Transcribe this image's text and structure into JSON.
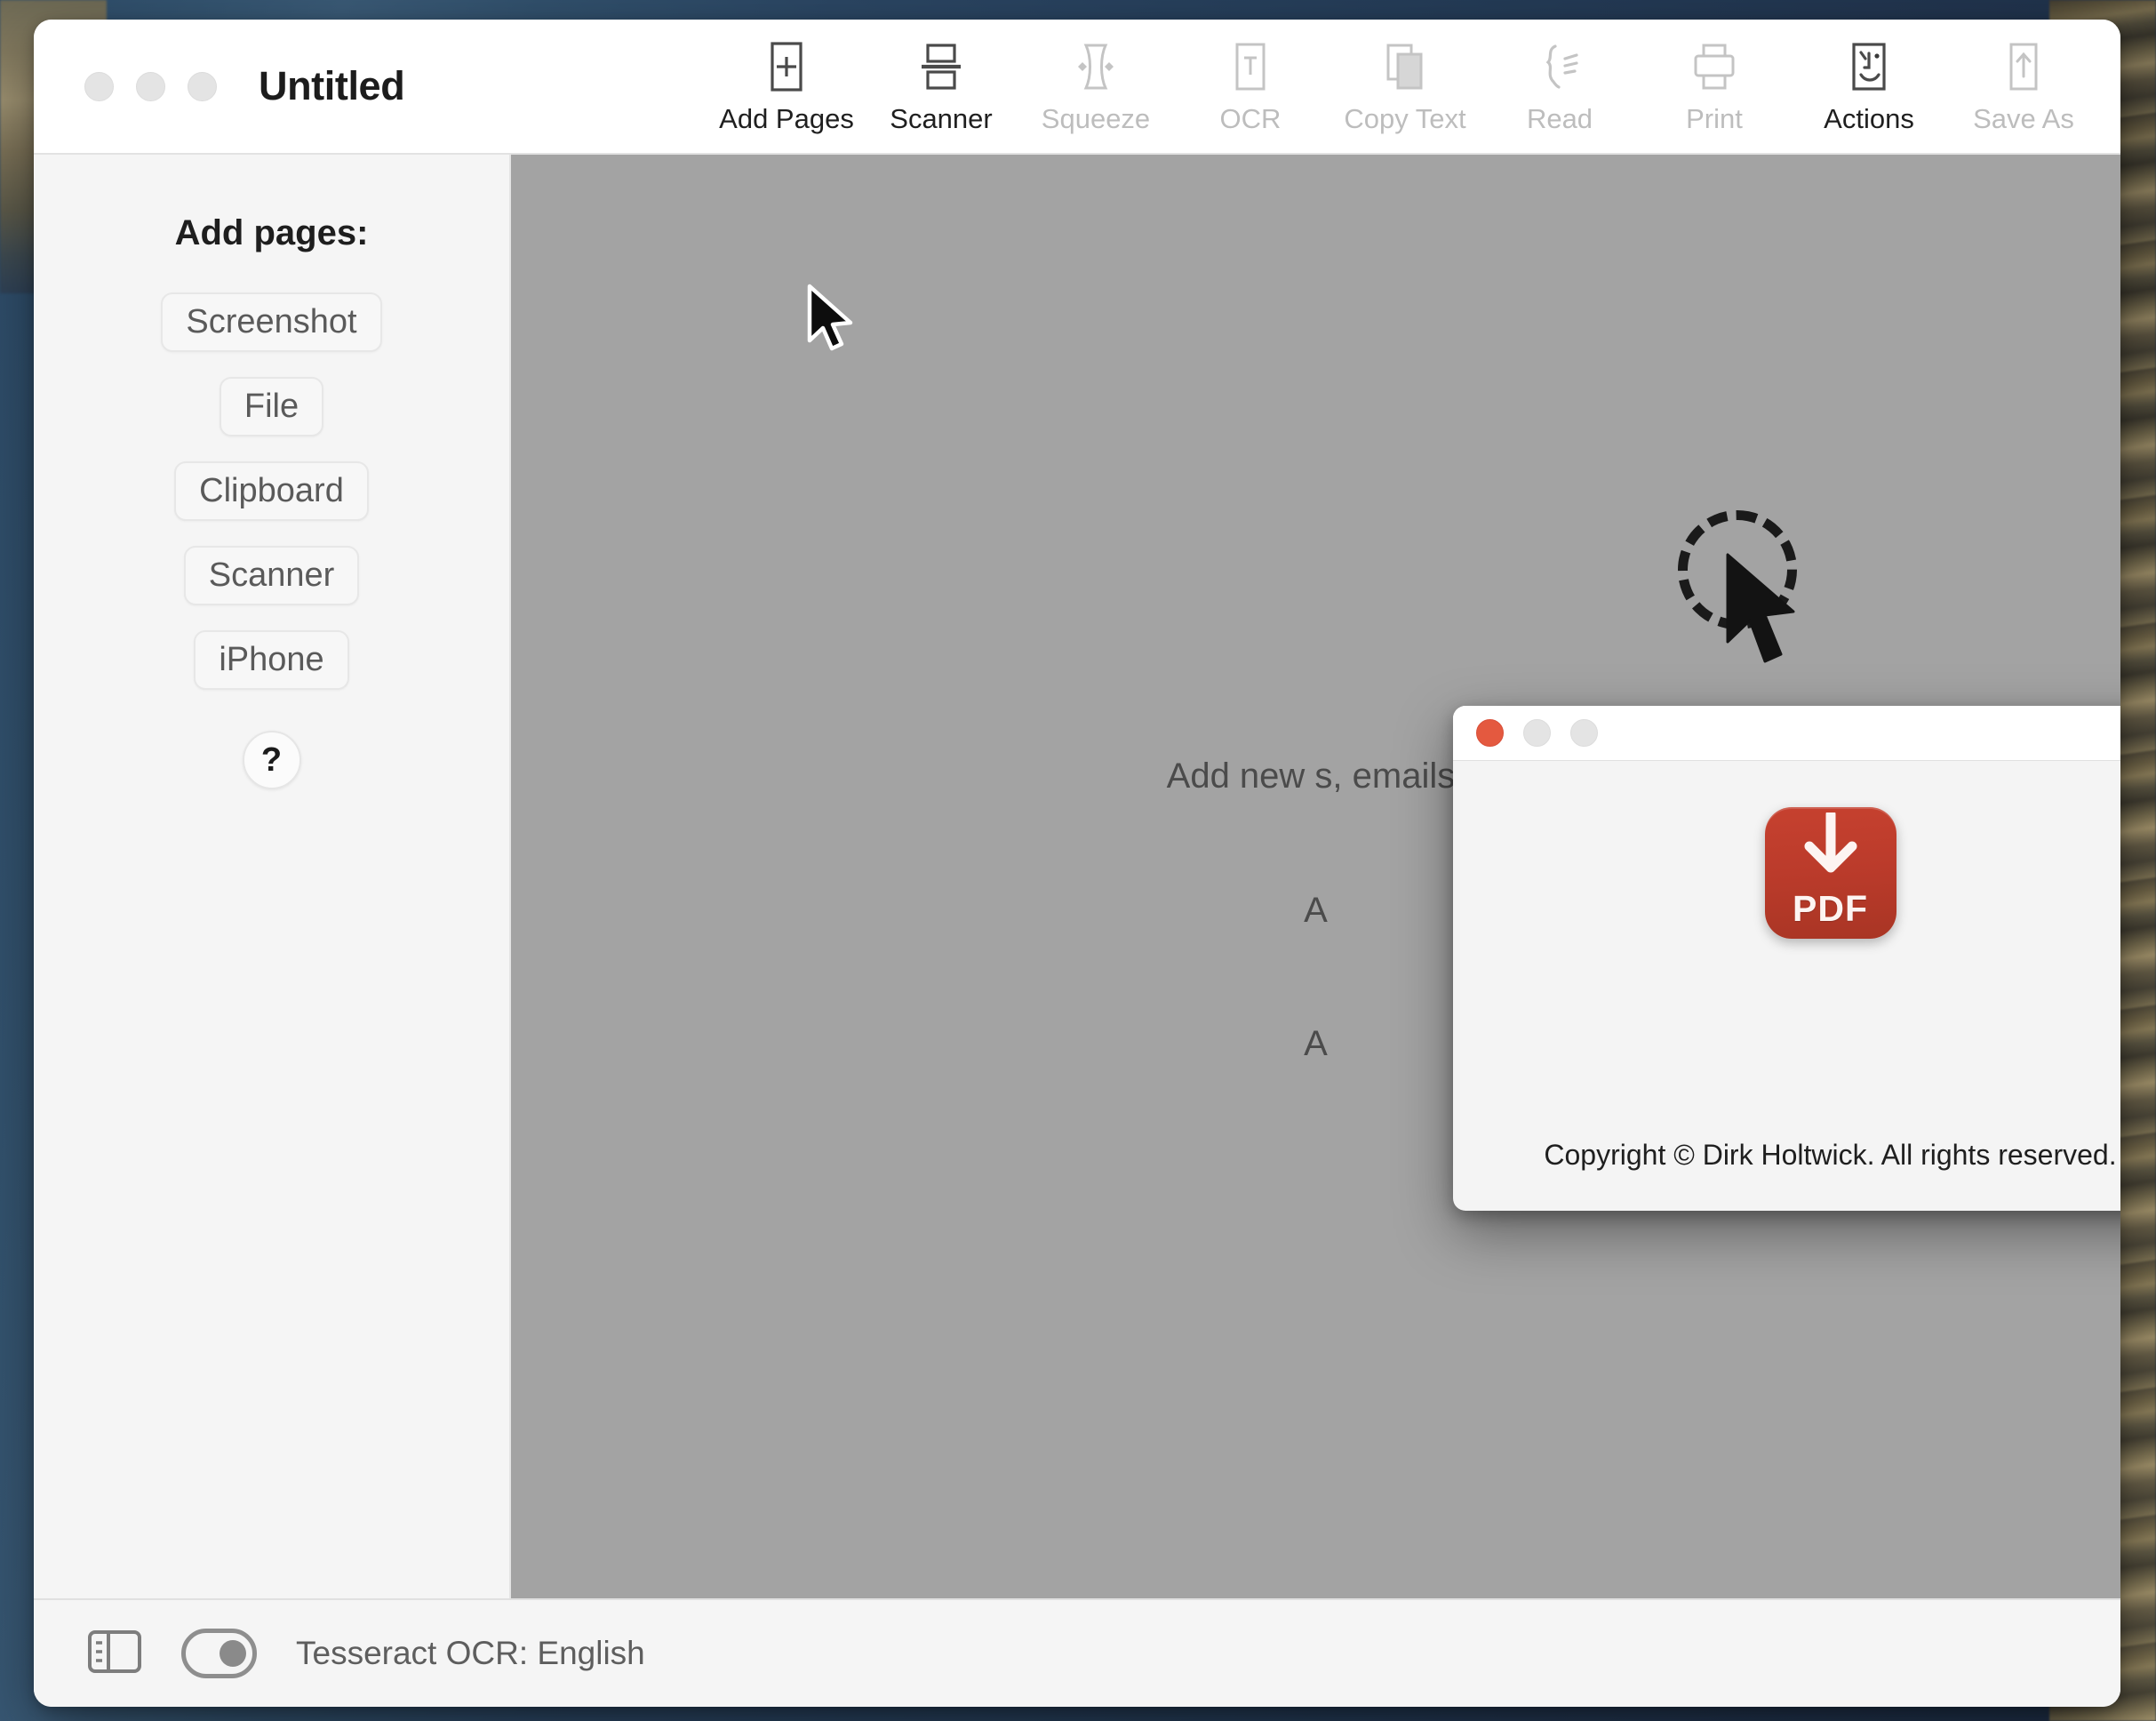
{
  "window": {
    "title": "Untitled",
    "traffic_lights": [
      "close",
      "minimize",
      "zoom"
    ]
  },
  "toolbar": {
    "items": [
      {
        "label": "Add Pages",
        "icon": "add-page-icon",
        "enabled": true
      },
      {
        "label": "Scanner",
        "icon": "scanner-icon",
        "enabled": true
      },
      {
        "label": "Squeeze",
        "icon": "squeeze-icon",
        "enabled": false
      },
      {
        "label": "OCR",
        "icon": "ocr-text-icon",
        "enabled": false
      },
      {
        "label": "Copy Text",
        "icon": "copy-icon",
        "enabled": false
      },
      {
        "label": "Read",
        "icon": "read-aloud-icon",
        "enabled": false
      },
      {
        "label": "Print",
        "icon": "printer-icon",
        "enabled": false
      },
      {
        "label": "Actions",
        "icon": "finder-face-icon",
        "enabled": true
      },
      {
        "label": "Save As",
        "icon": "share-up-icon",
        "enabled": false
      }
    ],
    "overflow_label": "»"
  },
  "sidebar": {
    "heading": "Add pages:",
    "buttons": [
      {
        "label": "Screenshot"
      },
      {
        "label": "File"
      },
      {
        "label": "Clipboard"
      },
      {
        "label": "Scanner"
      },
      {
        "label": "iPhone"
      }
    ],
    "help_label": "?"
  },
  "content": {
    "hint_lines": [
      "Add new                                                         s, emails,",
      "A",
      "A"
    ],
    "background_color": "#a3a3a3"
  },
  "about_modal": {
    "app_icon_label": "PDF",
    "copyright": "Copyright © Dirk Holtwick. All rights reserved.",
    "icon_color": "#bb3b2b",
    "traffic_lights": [
      "close",
      "minimize",
      "zoom"
    ]
  },
  "statusbar": {
    "sidebar_toggle_icon": "sidebar-toggle-icon",
    "ocr_toggle_state": "on",
    "ocr_status": "Tesseract OCR: English"
  }
}
